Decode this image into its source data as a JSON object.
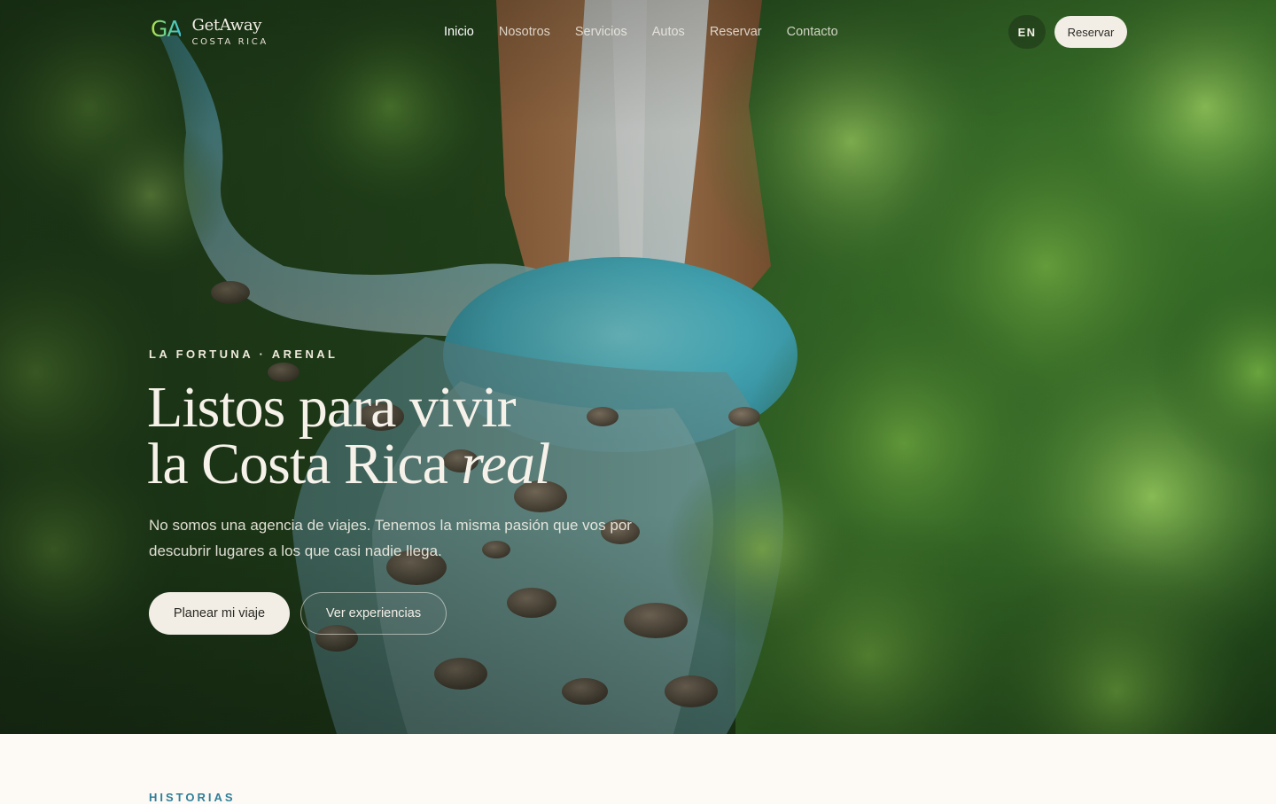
{
  "brand": {
    "mark": "GA",
    "name": "GetAway",
    "subtitle": "COSTA RICA"
  },
  "nav": {
    "items": [
      {
        "label": "Inicio",
        "active": true
      },
      {
        "label": "Nosotros",
        "active": false
      },
      {
        "label": "Servicios",
        "active": false
      },
      {
        "label": "Autos",
        "active": false
      },
      {
        "label": "Reservar",
        "active": false
      },
      {
        "label": "Contacto",
        "active": false
      }
    ],
    "language_toggle": "EN",
    "cta_label": "Reservar"
  },
  "hero": {
    "eyebrow": "LA FORTUNA · ARENAL",
    "title_line1": "Listos para vivir",
    "title_line2_prefix": "la Costa Rica ",
    "title_line2_emphasis": "real",
    "lede": "No somos una agencia de viajes. Tenemos la misma pasión que vos por descubrir lugares a los que casi nadie llega.",
    "primary_cta": "Planear mi viaje",
    "secondary_cta": "Ver experiencias",
    "background": "waterfall-rainforest-photo"
  },
  "next_section": {
    "eyebrow": "HISTORIAS"
  },
  "colors": {
    "cream": "#f2eee6",
    "page_background": "#fdf9f4",
    "accent_teal": "#2f7f99",
    "logo_gradient_start": "#b7e24a",
    "logo_gradient_end": "#3ec3d6"
  }
}
